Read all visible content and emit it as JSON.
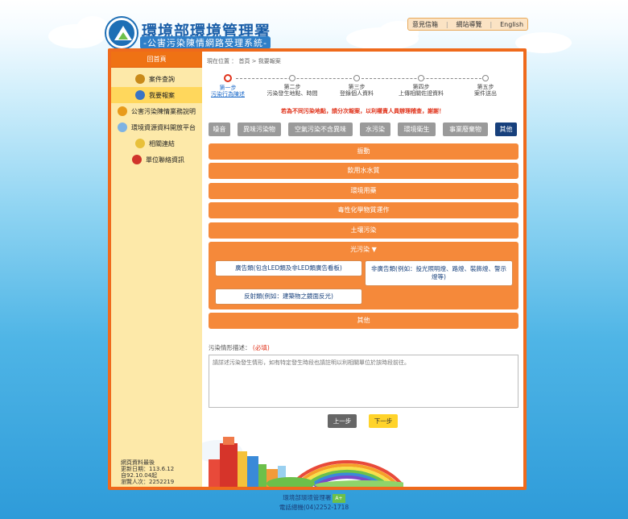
{
  "header": {
    "title": "環境部環境管理署",
    "subtitle": "-公害污染陳情網路受理系統-",
    "links": [
      "意見信箱",
      "網站導覽",
      "English"
    ]
  },
  "sidebar": {
    "home": "回首頁",
    "items": [
      {
        "label": "案件查詢",
        "color": "#c98a1a"
      },
      {
        "label": "我要報案",
        "color": "#3a74c4"
      },
      {
        "label": "公害污染陳情業務說明",
        "color": "#e89a1a"
      },
      {
        "label": "環境資源資料開放平台",
        "color": "#7fb3e3"
      },
      {
        "label": "相關連結",
        "color": "#e8c03a"
      },
      {
        "label": "單位聯絡資訊",
        "color": "#d0342a"
      }
    ],
    "stats": [
      "網頁資料最後",
      "更新日期：113.6.12",
      "自92.10.04起",
      "瀏覽人次：2252219"
    ]
  },
  "main": {
    "breadcrumb": "現在位置 ： 首頁 > 我要報案",
    "steps": [
      {
        "l1": "第一步",
        "l2": "污染行為陳述"
      },
      {
        "l1": "第二步",
        "l2": "污染發生地點、時間"
      },
      {
        "l1": "第三步",
        "l2": "登錄個人資料"
      },
      {
        "l1": "第四步",
        "l2": "上傳相關佐證資料"
      },
      {
        "l1": "第五步",
        "l2": "案件送出"
      }
    ],
    "notice": "若為不同污染地點，請分次報案，以利權責人員辦理稽查，謝謝！",
    "categories": [
      "噪音",
      "異味污染物",
      "空氣污染不含異味",
      "水污染",
      "環境衛生",
      "事業廢棄物",
      "其他"
    ],
    "bars": [
      "振動",
      "飲用水水質",
      "環境用藥",
      "毒性化學物質運作",
      "土壤污染"
    ],
    "panel": {
      "title": "光污染 ▼",
      "options": [
        "廣告類(包含LED類及非LED類廣告看板)",
        "非廣告類(例如：投光照明燈、路燈、裝飾燈、警示燈等)",
        "反射類(例如：建築物之鏡面反光)"
      ]
    },
    "last_bar": "其他",
    "desc_label": "污染情形描述：",
    "desc_required": "(必填)",
    "desc_placeholder": "請詳述污染發生情形，如有特定發生時段也請註明以利相關單位於該時段前往。",
    "prev_label": "上一步",
    "next_label": "下一步"
  },
  "footer": {
    "line1": "環境部環境管理署",
    "line2": "電話總機(04)2252-1718"
  },
  "colors": {
    "accent": "#ef6a1c",
    "selected": "#17407c",
    "bar": "#f5893a"
  }
}
